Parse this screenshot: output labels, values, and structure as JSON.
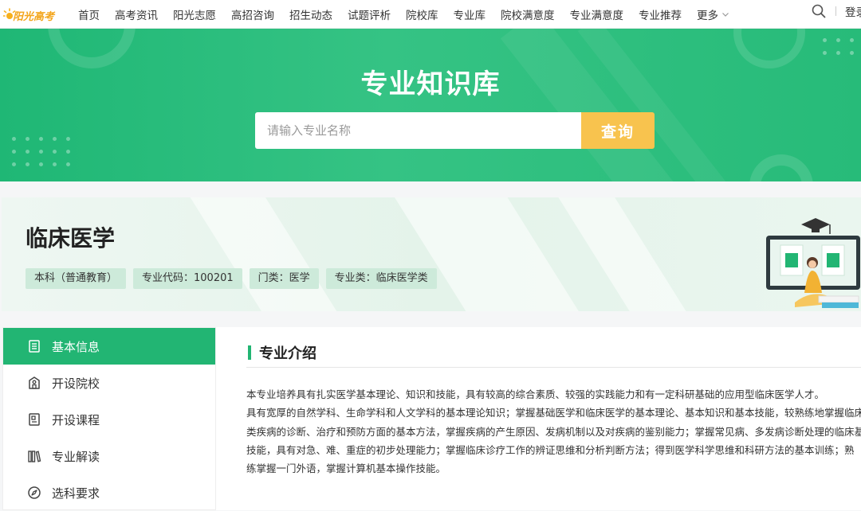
{
  "brand": {
    "logo_text": "阳光高考"
  },
  "nav": {
    "items": [
      "首页",
      "高考资讯",
      "阳光志愿",
      "高招咨询",
      "招生动态",
      "试题评析",
      "院校库",
      "专业库",
      "院校满意度",
      "专业满意度",
      "专业推荐"
    ],
    "more_label": "更多",
    "login_label": "登录"
  },
  "banner": {
    "title": "专业知识库",
    "search_placeholder": "请输入专业名称",
    "search_button": "查询"
  },
  "major": {
    "name": "临床医学",
    "tags": [
      "本科（普通教育）",
      "专业代码：100201",
      "门类：医学",
      "专业类：临床医学类"
    ]
  },
  "sidebar": {
    "items": [
      {
        "label": "基本信息",
        "icon": "document-list-icon",
        "active": true
      },
      {
        "label": "开设院校",
        "icon": "school-building-icon",
        "active": false
      },
      {
        "label": "开设课程",
        "icon": "course-book-icon",
        "active": false
      },
      {
        "label": "专业解读",
        "icon": "books-shelf-icon",
        "active": false
      },
      {
        "label": "选科要求",
        "icon": "compass-icon",
        "active": false
      }
    ]
  },
  "content": {
    "section_title": "专业介绍",
    "intro_lines": [
      "本专业培养具有扎实医学基本理论、知识和技能，具有较高的综合素质、较强的实践能力和有一定科研基础的应用型临床医学人才。",
      "具有宽厚的自然学科、生命学科和人文学科的基本理论知识；掌握基础医学和临床医学的基本理论、基本知识和基本技能，较熟练地掌握临床常见病、",
      "类疾病的诊断、治疗和预防方面的基本方法，掌握疾病的产生原因、发病机制以及对疾病的鉴别能力；掌握常见病、多发病诊断处理的临床基本",
      "技能，具有对急、难、重症的初步处理能力；掌握临床诊疗工作的辨证思维和分析判断方法；得到医学科学思维和科研方法的基本训练；熟",
      "练掌握一门外语，掌握计算机基本操作技能。"
    ]
  },
  "colors": {
    "primary_green": "#22b573",
    "search_button": "#f8c34e",
    "tag_bg": "#cdeada"
  }
}
